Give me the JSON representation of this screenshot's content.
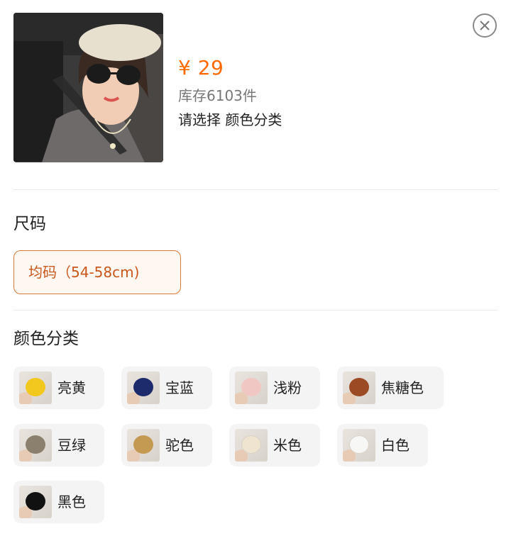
{
  "product": {
    "price": "¥ 29",
    "stock": "库存6103件",
    "select_hint": "请选择 颜色分类"
  },
  "size_section": {
    "title": "尺码",
    "options": [
      {
        "label": "均码（54-58cm)",
        "selected": true
      }
    ]
  },
  "color_section": {
    "title": "颜色分类",
    "options": [
      {
        "label": "亮黄",
        "color": "#f2c81e"
      },
      {
        "label": "宝蓝",
        "color": "#1d2a6b"
      },
      {
        "label": "浅粉",
        "color": "#f1c7c4"
      },
      {
        "label": "焦糖色",
        "color": "#9c4a24"
      },
      {
        "label": "豆绿",
        "color": "#8b7f6e"
      },
      {
        "label": "驼色",
        "color": "#c49a52"
      },
      {
        "label": "米色",
        "color": "#eee4cf"
      },
      {
        "label": "白色",
        "color": "#f7f7f5"
      },
      {
        "label": "黑色",
        "color": "#111111"
      }
    ]
  },
  "colors": {
    "accent_price": "#ff6a00",
    "selected_chip_border": "#d77a3a",
    "selected_chip_text": "#c9561a"
  },
  "icons": {
    "close": "close-icon"
  }
}
